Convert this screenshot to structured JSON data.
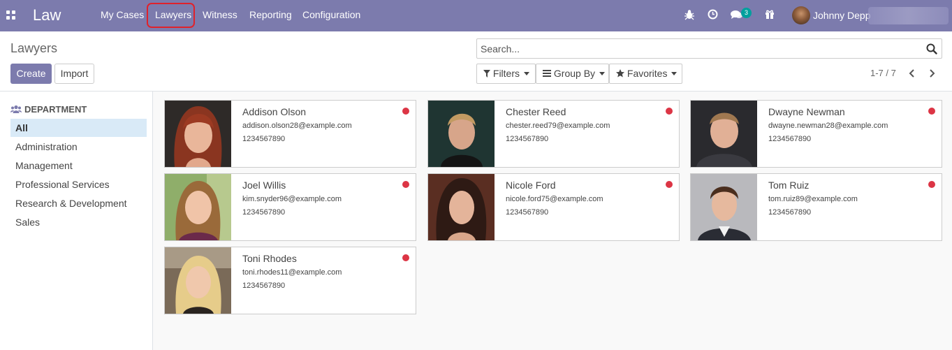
{
  "app": {
    "brand": "Law"
  },
  "menu": [
    "My Cases",
    "Lawyers",
    "Witness",
    "Reporting",
    "Configuration"
  ],
  "systray": {
    "message_count": "3",
    "user_name": "Johnny Depp"
  },
  "control": {
    "title": "Lawyers",
    "create_label": "Create",
    "import_label": "Import",
    "search_placeholder": "Search...",
    "filters_label": "Filters",
    "groupby_label": "Group By",
    "favorites_label": "Favorites",
    "pager": "1-7 / 7"
  },
  "sidebar": {
    "heading": "DEPARTMENT",
    "items": [
      "All",
      "Administration",
      "Management",
      "Professional Services",
      "Research & Development",
      "Sales"
    ]
  },
  "cards": [
    {
      "name": "Addison Olson",
      "email": "addison.olson28@example.com",
      "phone": "1234567890"
    },
    {
      "name": "Chester Reed",
      "email": "chester.reed79@example.com",
      "phone": "1234567890"
    },
    {
      "name": "Dwayne Newman",
      "email": "dwayne.newman28@example.com",
      "phone": "1234567890"
    },
    {
      "name": "Joel Willis",
      "email": "kim.snyder96@example.com",
      "phone": "1234567890"
    },
    {
      "name": "Nicole Ford",
      "email": "nicole.ford75@example.com",
      "phone": "1234567890"
    },
    {
      "name": "Tom Ruiz",
      "email": "tom.ruiz89@example.com",
      "phone": "1234567890"
    },
    {
      "name": "Toni Rhodes",
      "email": "toni.rhodes11@example.com",
      "phone": "1234567890"
    }
  ],
  "colors": {
    "brand": "#7c7bad",
    "status_red": "#dc3545",
    "active_filter": "#d9eaf7"
  }
}
